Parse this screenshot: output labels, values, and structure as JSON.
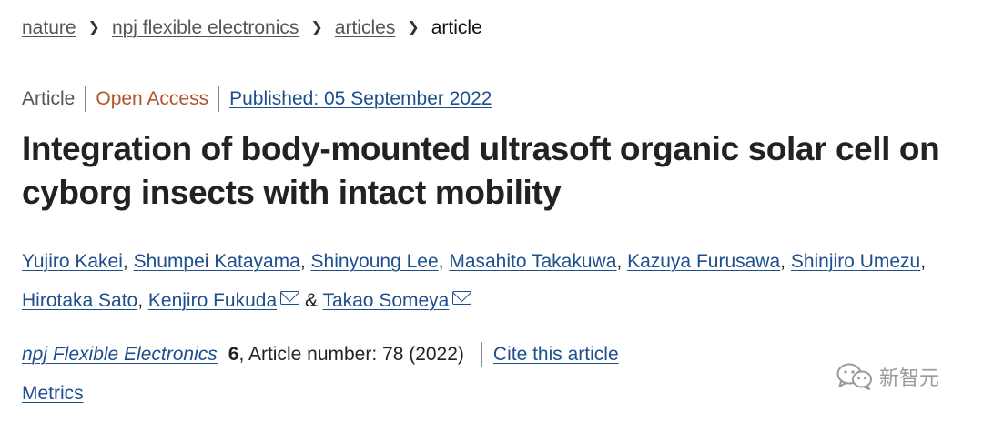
{
  "breadcrumb": {
    "items": [
      "nature",
      "npj flexible electronics",
      "articles"
    ],
    "current": "article"
  },
  "article_meta": {
    "type": "Article",
    "access": "Open Access",
    "published": "Published: 05 September 2022"
  },
  "title": "Integration of body-mounted ultrasoft organic solar cell on cyborg insects with intact mobility",
  "authors": [
    "Yujiro Kakei",
    "Shumpei Katayama",
    "Shinyoung Lee",
    "Masahito Takakuwa",
    "Kazuya Furusawa",
    "Shinjiro Umezu",
    "Hirotaka Sato",
    "Kenjiro Fukuda",
    "Takao Someya"
  ],
  "journal": {
    "name": "npj Flexible Electronics",
    "volume": "6",
    "article_number": ", Article number: 78 (2022)",
    "cite_label": "Cite this article"
  },
  "metrics_label": "Metrics",
  "watermark": {
    "icon": "wechat-icon",
    "text": "新智元"
  }
}
